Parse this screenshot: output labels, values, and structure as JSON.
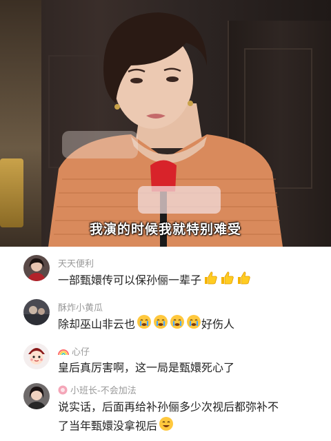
{
  "video": {
    "subtitle": "我演的时候我就特别难受"
  },
  "comments": [
    {
      "username": "天天便利",
      "avatar": "avatar-woman-dark-hair",
      "text": "一部甄嬛传可以保孙俪一辈子",
      "emojis": [
        "thumbs-up-icon",
        "thumbs-up-icon",
        "thumbs-up-icon"
      ]
    },
    {
      "username": "酥炸小黄瓜",
      "avatar": "avatar-photo",
      "text_before": "除却巫山非云也",
      "emojis": [
        "crying-face-icon",
        "crying-face-icon",
        "crying-face-icon",
        "crying-face-icon"
      ],
      "text_after": "好伤人"
    },
    {
      "username": "心仔",
      "avatar": "avatar-cartoon-character",
      "badge_icon": "rainbow-icon",
      "text": "皇后真厉害啊，这一局是甄嬛死心了"
    },
    {
      "username": "小班长-不会加法",
      "avatar": "avatar-woman-portrait",
      "badge_icon": "fan-badge-icon",
      "text_line1": "说实话，后面再给补孙俪多少次视后都弥补不",
      "text_line2": "了当年甄嬛没拿视后",
      "emojis": [
        "smiling-face-icon"
      ]
    }
  ],
  "colors": {
    "username": "#999999",
    "text": "#222222",
    "sweater": "#d98a5c",
    "microphone": "#d8232a"
  }
}
